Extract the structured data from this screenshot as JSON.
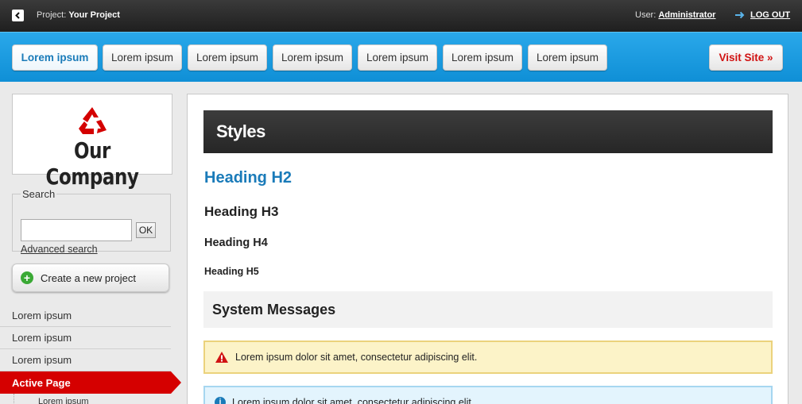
{
  "topbar": {
    "project_label": "Project:",
    "project_name": "Your Project",
    "user_label": "User:",
    "user_name": "Administrator",
    "logout": "LOG OUT"
  },
  "nav": {
    "tabs": [
      {
        "label": "Lorem ipsum",
        "active": true
      },
      {
        "label": "Lorem ipsum",
        "active": false
      },
      {
        "label": "Lorem ipsum",
        "active": false
      },
      {
        "label": "Lorem ipsum",
        "active": false
      },
      {
        "label": "Lorem ipsum",
        "active": false
      },
      {
        "label": "Lorem ipsum",
        "active": false
      },
      {
        "label": "Lorem ipsum",
        "active": false
      }
    ],
    "visit_site": "Visit Site »"
  },
  "sidebar": {
    "company": "Our Company",
    "search_legend": "Search",
    "search_value": "",
    "ok_label": "OK",
    "advanced_search": "Advanced search",
    "create_project": "Create a new project",
    "items": [
      {
        "label": "Lorem ipsum"
      },
      {
        "label": "Lorem ipsum"
      },
      {
        "label": "Lorem ipsum"
      },
      {
        "label": "Active Page"
      }
    ],
    "sub_items": [
      {
        "label": "Lorem ipsum"
      }
    ]
  },
  "main": {
    "title": "Styles",
    "h2": "Heading H2",
    "h3": "Heading H3",
    "h4": "Heading H4",
    "h5": "Heading H5",
    "system_messages": "System Messages",
    "warning_text": "Lorem ipsum dolor sit amet, consectetur adipiscing elit.",
    "info_text": "Lorem ipsum dolor sit amet, consectetur adipiscing elit."
  },
  "colors": {
    "accent_blue": "#1a7bb9",
    "nav_blue": "#1b9ce2",
    "active_red": "#d50000",
    "warning_bg": "#fcf3c8",
    "info_bg": "#e3f4fd"
  },
  "icons": {
    "back": "back-arrow-icon",
    "logout": "logout-arrow-icon",
    "logo": "recycle-icon",
    "create": "plus-circle-icon",
    "warning": "warning-triangle-icon",
    "info": "info-circle-icon"
  }
}
